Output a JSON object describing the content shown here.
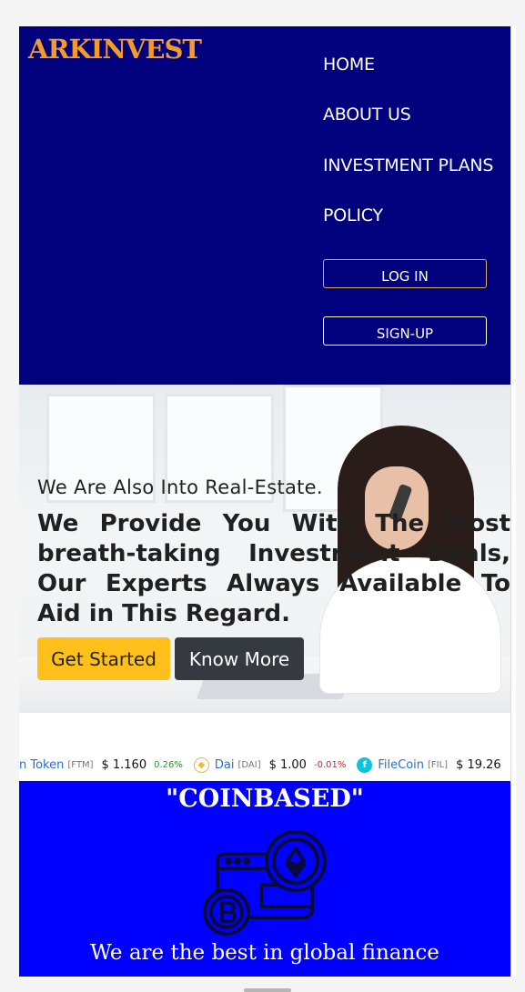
{
  "header": {
    "brand": "ARKINVEST",
    "nav": [
      "HOME",
      "ABOUT US",
      "INVESTMENT PLANS",
      "POLICY"
    ],
    "login_label": "LOG IN",
    "signup_label": "SIGN-UP",
    "colors": {
      "background": "#01017e",
      "brand": "#f49b26"
    }
  },
  "hero": {
    "subtitle": "We Are Also Into Real-Estate.",
    "title": "We Provide You With The Most breath-taking Investment Deals, Our Experts Always Available To Aid in This Regard.",
    "primary_button": "Get Started",
    "secondary_button": "Know More",
    "colors": {
      "primary": "#ffc01b",
      "secondary": "#343a40"
    }
  },
  "ticker": [
    {
      "name": "n Token",
      "symbol": "[FTM]",
      "price": "$ 1.160",
      "change": "0.26%",
      "direction": "up",
      "icon": ""
    },
    {
      "name": "Dai",
      "symbol": "[DAI]",
      "price": "$ 1.00",
      "change": "-0.01%",
      "direction": "down",
      "icon": "dai-icon"
    },
    {
      "name": "FileCoin",
      "symbol": "[FIL]",
      "price": "$ 19.26",
      "change": "",
      "direction": "",
      "icon": "filecoin-icon"
    }
  ],
  "coinbase": {
    "title": "\"COINBASED\"",
    "tagline": "We are the best in global finance",
    "illustration": "crypto-wallet-icon",
    "colors": {
      "background": "#0000ff"
    }
  }
}
